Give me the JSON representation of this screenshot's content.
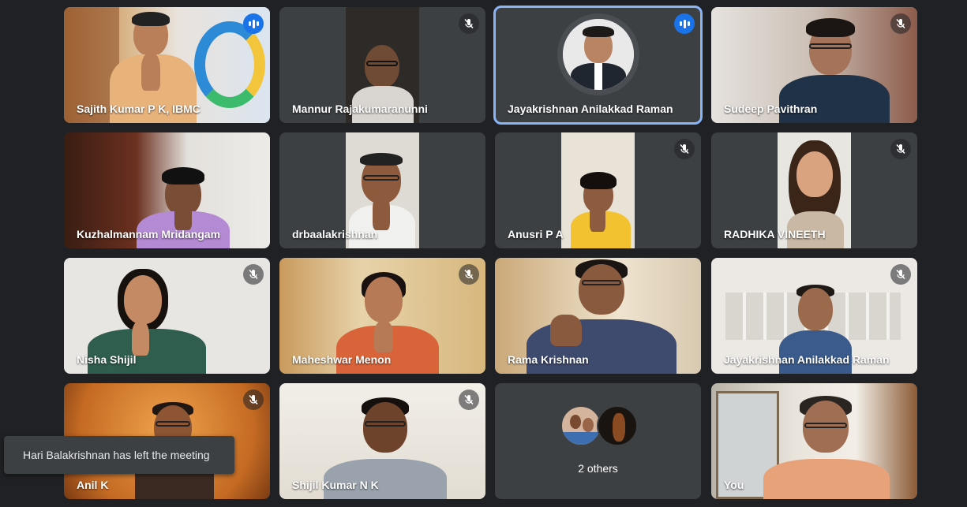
{
  "participants": [
    {
      "name": "Sajith Kumar P K, IBMC",
      "mic": "speaking"
    },
    {
      "name": "Mannur Rajakumaranunni",
      "mic": "muted"
    },
    {
      "name": "Jayakrishnan Anilakkad Raman",
      "mic": "speaking",
      "active": true
    },
    {
      "name": "Sudeep Pavithran",
      "mic": "muted"
    },
    {
      "name": "Kuzhalmannam Mridangam",
      "mic": "none"
    },
    {
      "name": "drbaalakrishnan",
      "mic": "none"
    },
    {
      "name": "Anusri P A",
      "mic": "muted"
    },
    {
      "name": "RADHIKA VINEETH",
      "mic": "muted"
    },
    {
      "name": "Nisha Shijil",
      "mic": "muted"
    },
    {
      "name": "Maheshwar Menon",
      "mic": "muted"
    },
    {
      "name": "Rama Krishnan",
      "mic": "none"
    },
    {
      "name": "Jayakrishnan Anilakkad Raman",
      "mic": "muted"
    },
    {
      "name": "Anil K",
      "mic": "muted"
    },
    {
      "name": "Shijil Kumar N K",
      "mic": "muted"
    }
  ],
  "others_tile": {
    "label": "2 others"
  },
  "self_tile": {
    "name": "You"
  },
  "toast": {
    "message": "Hari Balakrishnan has left the meeting"
  },
  "colors": {
    "background": "#202124",
    "tile": "#3c4043",
    "accent": "#8ab4f8",
    "speaking": "#1a73e8"
  },
  "icons": {
    "muted": "mic-off-icon",
    "speaking": "audio-level-icon"
  }
}
